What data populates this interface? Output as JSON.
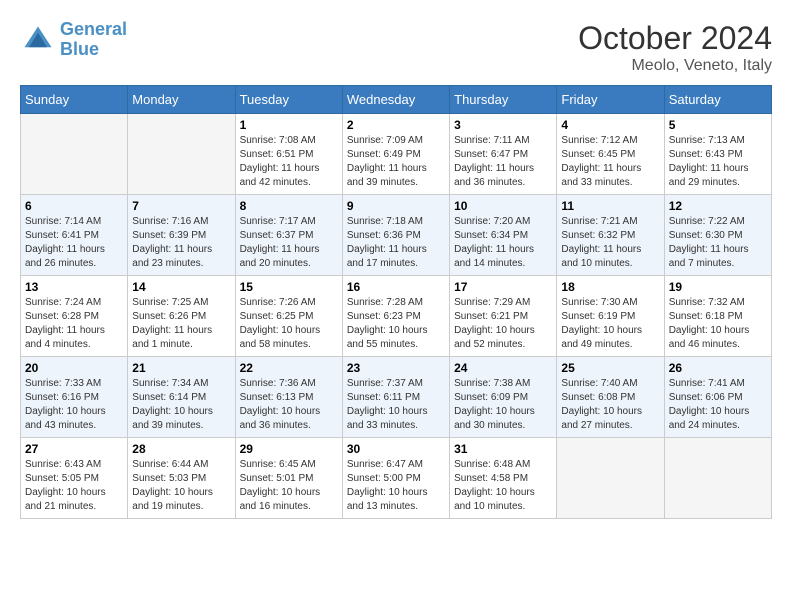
{
  "header": {
    "logo_line1": "General",
    "logo_line2": "Blue",
    "month": "October 2024",
    "location": "Meolo, Veneto, Italy"
  },
  "weekdays": [
    "Sunday",
    "Monday",
    "Tuesday",
    "Wednesday",
    "Thursday",
    "Friday",
    "Saturday"
  ],
  "weeks": [
    [
      {
        "day": "",
        "sunrise": "",
        "sunset": "",
        "daylight": "",
        "empty": true
      },
      {
        "day": "",
        "sunrise": "",
        "sunset": "",
        "daylight": "",
        "empty": true
      },
      {
        "day": "1",
        "sunrise": "Sunrise: 7:08 AM",
        "sunset": "Sunset: 6:51 PM",
        "daylight": "Daylight: 11 hours and 42 minutes."
      },
      {
        "day": "2",
        "sunrise": "Sunrise: 7:09 AM",
        "sunset": "Sunset: 6:49 PM",
        "daylight": "Daylight: 11 hours and 39 minutes."
      },
      {
        "day": "3",
        "sunrise": "Sunrise: 7:11 AM",
        "sunset": "Sunset: 6:47 PM",
        "daylight": "Daylight: 11 hours and 36 minutes."
      },
      {
        "day": "4",
        "sunrise": "Sunrise: 7:12 AM",
        "sunset": "Sunset: 6:45 PM",
        "daylight": "Daylight: 11 hours and 33 minutes."
      },
      {
        "day": "5",
        "sunrise": "Sunrise: 7:13 AM",
        "sunset": "Sunset: 6:43 PM",
        "daylight": "Daylight: 11 hours and 29 minutes."
      }
    ],
    [
      {
        "day": "6",
        "sunrise": "Sunrise: 7:14 AM",
        "sunset": "Sunset: 6:41 PM",
        "daylight": "Daylight: 11 hours and 26 minutes."
      },
      {
        "day": "7",
        "sunrise": "Sunrise: 7:16 AM",
        "sunset": "Sunset: 6:39 PM",
        "daylight": "Daylight: 11 hours and 23 minutes."
      },
      {
        "day": "8",
        "sunrise": "Sunrise: 7:17 AM",
        "sunset": "Sunset: 6:37 PM",
        "daylight": "Daylight: 11 hours and 20 minutes."
      },
      {
        "day": "9",
        "sunrise": "Sunrise: 7:18 AM",
        "sunset": "Sunset: 6:36 PM",
        "daylight": "Daylight: 11 hours and 17 minutes."
      },
      {
        "day": "10",
        "sunrise": "Sunrise: 7:20 AM",
        "sunset": "Sunset: 6:34 PM",
        "daylight": "Daylight: 11 hours and 14 minutes."
      },
      {
        "day": "11",
        "sunrise": "Sunrise: 7:21 AM",
        "sunset": "Sunset: 6:32 PM",
        "daylight": "Daylight: 11 hours and 10 minutes."
      },
      {
        "day": "12",
        "sunrise": "Sunrise: 7:22 AM",
        "sunset": "Sunset: 6:30 PM",
        "daylight": "Daylight: 11 hours and 7 minutes."
      }
    ],
    [
      {
        "day": "13",
        "sunrise": "Sunrise: 7:24 AM",
        "sunset": "Sunset: 6:28 PM",
        "daylight": "Daylight: 11 hours and 4 minutes."
      },
      {
        "day": "14",
        "sunrise": "Sunrise: 7:25 AM",
        "sunset": "Sunset: 6:26 PM",
        "daylight": "Daylight: 11 hours and 1 minute."
      },
      {
        "day": "15",
        "sunrise": "Sunrise: 7:26 AM",
        "sunset": "Sunset: 6:25 PM",
        "daylight": "Daylight: 10 hours and 58 minutes."
      },
      {
        "day": "16",
        "sunrise": "Sunrise: 7:28 AM",
        "sunset": "Sunset: 6:23 PM",
        "daylight": "Daylight: 10 hours and 55 minutes."
      },
      {
        "day": "17",
        "sunrise": "Sunrise: 7:29 AM",
        "sunset": "Sunset: 6:21 PM",
        "daylight": "Daylight: 10 hours and 52 minutes."
      },
      {
        "day": "18",
        "sunrise": "Sunrise: 7:30 AM",
        "sunset": "Sunset: 6:19 PM",
        "daylight": "Daylight: 10 hours and 49 minutes."
      },
      {
        "day": "19",
        "sunrise": "Sunrise: 7:32 AM",
        "sunset": "Sunset: 6:18 PM",
        "daylight": "Daylight: 10 hours and 46 minutes."
      }
    ],
    [
      {
        "day": "20",
        "sunrise": "Sunrise: 7:33 AM",
        "sunset": "Sunset: 6:16 PM",
        "daylight": "Daylight: 10 hours and 43 minutes."
      },
      {
        "day": "21",
        "sunrise": "Sunrise: 7:34 AM",
        "sunset": "Sunset: 6:14 PM",
        "daylight": "Daylight: 10 hours and 39 minutes."
      },
      {
        "day": "22",
        "sunrise": "Sunrise: 7:36 AM",
        "sunset": "Sunset: 6:13 PM",
        "daylight": "Daylight: 10 hours and 36 minutes."
      },
      {
        "day": "23",
        "sunrise": "Sunrise: 7:37 AM",
        "sunset": "Sunset: 6:11 PM",
        "daylight": "Daylight: 10 hours and 33 minutes."
      },
      {
        "day": "24",
        "sunrise": "Sunrise: 7:38 AM",
        "sunset": "Sunset: 6:09 PM",
        "daylight": "Daylight: 10 hours and 30 minutes."
      },
      {
        "day": "25",
        "sunrise": "Sunrise: 7:40 AM",
        "sunset": "Sunset: 6:08 PM",
        "daylight": "Daylight: 10 hours and 27 minutes."
      },
      {
        "day": "26",
        "sunrise": "Sunrise: 7:41 AM",
        "sunset": "Sunset: 6:06 PM",
        "daylight": "Daylight: 10 hours and 24 minutes."
      }
    ],
    [
      {
        "day": "27",
        "sunrise": "Sunrise: 6:43 AM",
        "sunset": "Sunset: 5:05 PM",
        "daylight": "Daylight: 10 hours and 21 minutes."
      },
      {
        "day": "28",
        "sunrise": "Sunrise: 6:44 AM",
        "sunset": "Sunset: 5:03 PM",
        "daylight": "Daylight: 10 hours and 19 minutes."
      },
      {
        "day": "29",
        "sunrise": "Sunrise: 6:45 AM",
        "sunset": "Sunset: 5:01 PM",
        "daylight": "Daylight: 10 hours and 16 minutes."
      },
      {
        "day": "30",
        "sunrise": "Sunrise: 6:47 AM",
        "sunset": "Sunset: 5:00 PM",
        "daylight": "Daylight: 10 hours and 13 minutes."
      },
      {
        "day": "31",
        "sunrise": "Sunrise: 6:48 AM",
        "sunset": "Sunset: 4:58 PM",
        "daylight": "Daylight: 10 hours and 10 minutes."
      },
      {
        "day": "",
        "sunrise": "",
        "sunset": "",
        "daylight": "",
        "empty": true
      },
      {
        "day": "",
        "sunrise": "",
        "sunset": "",
        "daylight": "",
        "empty": true
      }
    ]
  ]
}
